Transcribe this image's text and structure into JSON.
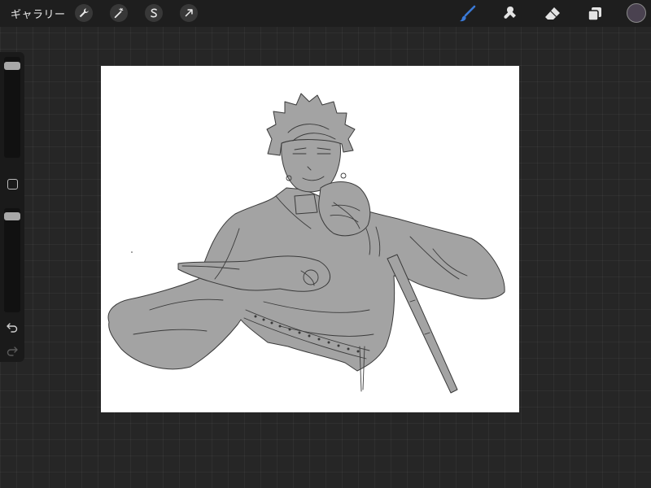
{
  "topbar": {
    "gallery_label": "ギャラリー",
    "left_tools": [
      "wrench-icon",
      "magic-wand-icon",
      "selection-icon",
      "transform-arrow-icon"
    ],
    "right_tools": [
      "brush-icon",
      "smudge-icon",
      "eraser-icon",
      "layers-icon"
    ],
    "active_tool": "brush-icon",
    "active_color": "#3a79d6",
    "current_color": "#4a4250"
  },
  "sidebar": {
    "controls": [
      "brush-size-slider",
      "modify-button",
      "opacity-slider",
      "undo-icon",
      "redo-icon"
    ],
    "brush_size": 0.05,
    "opacity": 0.04
  },
  "canvas": {
    "background": "#ffffff",
    "sketch_fill": "#a3a3a3",
    "sketch_stroke": "#3a3a3a"
  }
}
